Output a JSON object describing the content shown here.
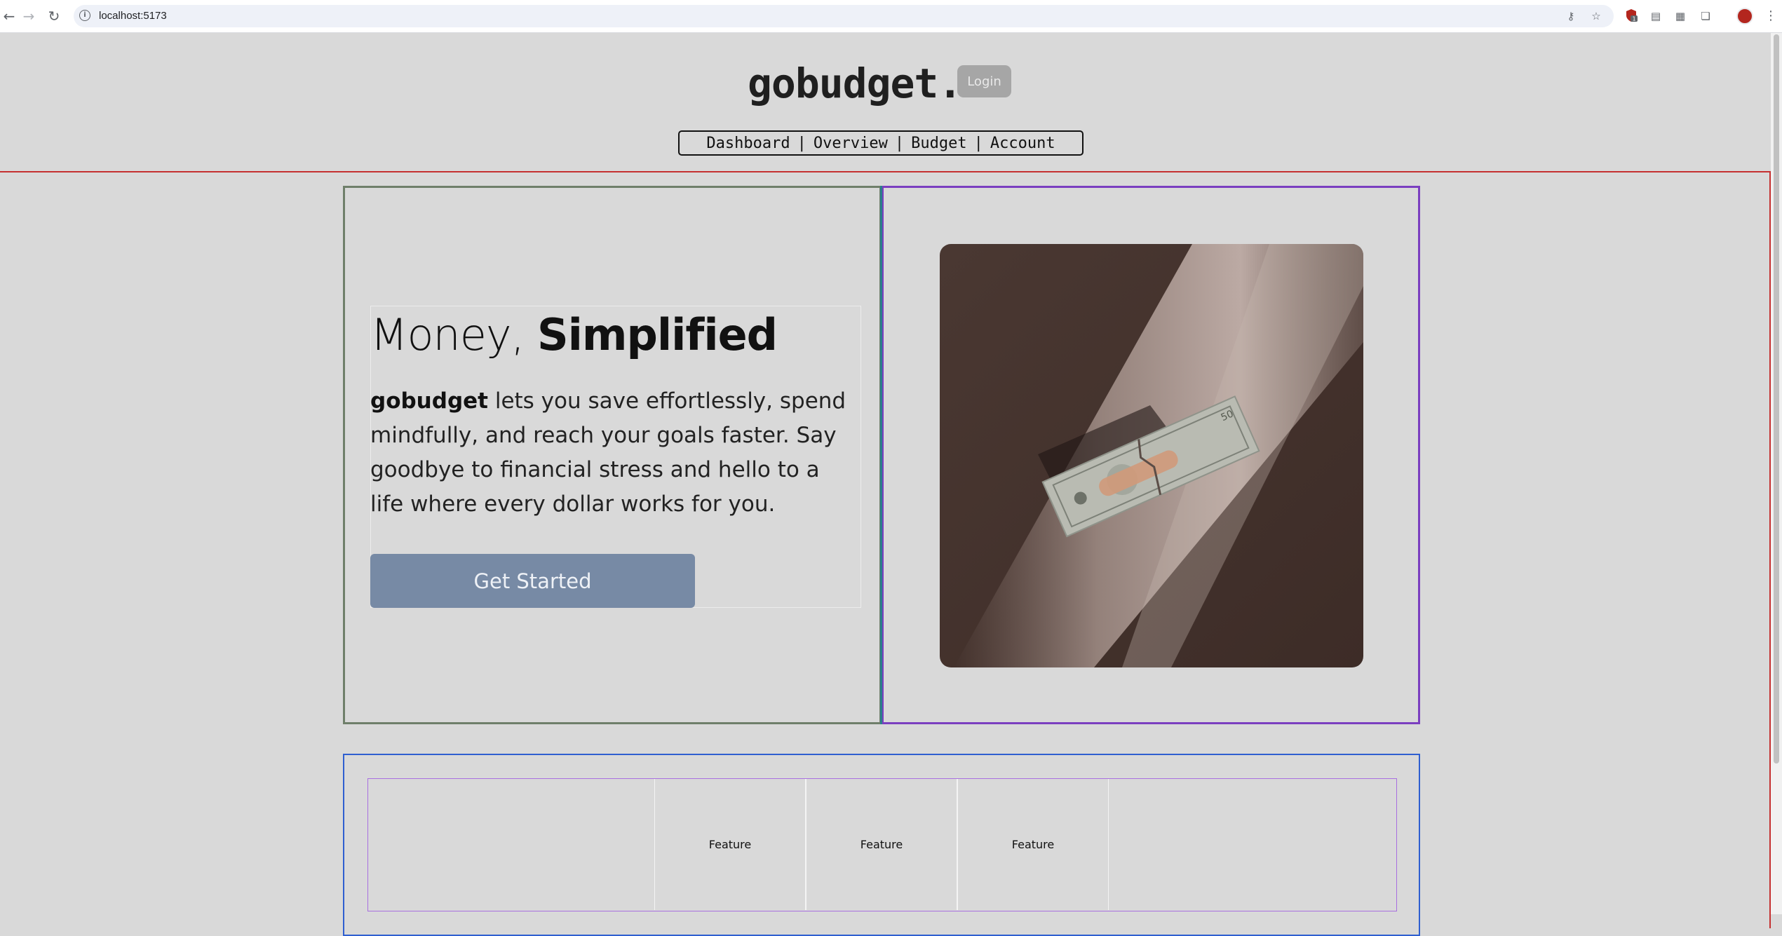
{
  "browser": {
    "url": "localhost:5173",
    "extension_badge": "1"
  },
  "header": {
    "brand": "gobudget.",
    "login_label": "Login",
    "nav": [
      "Dashboard",
      "Overview",
      "Budget",
      "Account"
    ],
    "nav_separator": "|"
  },
  "hero": {
    "headline_light": "Money, ",
    "headline_bold": "Simplified",
    "description_bold": "gobudget",
    "description_rest": " lets you save effortlessly, spend mindfully, and reach your goals faster. Say goodbye to financial stress and hello to a life where every dollar works for you.",
    "cta_label": "Get Started"
  },
  "features": {
    "items": [
      "Feature",
      "Feature",
      "Feature"
    ]
  },
  "colors": {
    "page_background": "#d9d9d9",
    "cta_background": "#778aa5",
    "login_background": "#a6a6a6",
    "debug_red": "#c53030",
    "debug_purple": "#7b3fc0",
    "debug_blue": "#2f5fd0",
    "debug_teal": "#2b7f8c"
  }
}
